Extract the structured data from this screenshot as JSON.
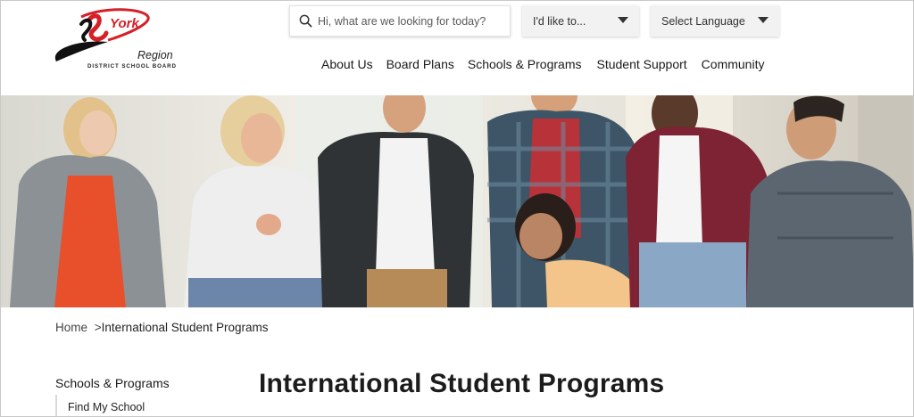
{
  "logo": {
    "name_top": "York",
    "name_bottom": "Region",
    "subtitle": "DISTRICT SCHOOL BOARD"
  },
  "search": {
    "placeholder": "Hi, what are we looking for today?"
  },
  "dropdowns": {
    "id_like_to": "I'd like to...",
    "language": "Select Language"
  },
  "nav": [
    {
      "label": "About Us"
    },
    {
      "label": "Board Plans"
    },
    {
      "label": "Schools & Programs"
    },
    {
      "label": "Student Support"
    },
    {
      "label": "Community"
    }
  ],
  "breadcrumb": {
    "home": "Home",
    "separator": ">",
    "current": "International Student Programs"
  },
  "sidebar": {
    "title": "Schools & Programs",
    "items": [
      {
        "label": "Find My School"
      }
    ]
  },
  "page": {
    "title": "International Student Programs"
  },
  "colors": {
    "brand_red": "#d62027",
    "nav_text": "#1a1a1a",
    "dropdown_bg": "#f2f2f2"
  },
  "icons": {
    "search": "search-icon",
    "caret": "caret-down-icon"
  }
}
